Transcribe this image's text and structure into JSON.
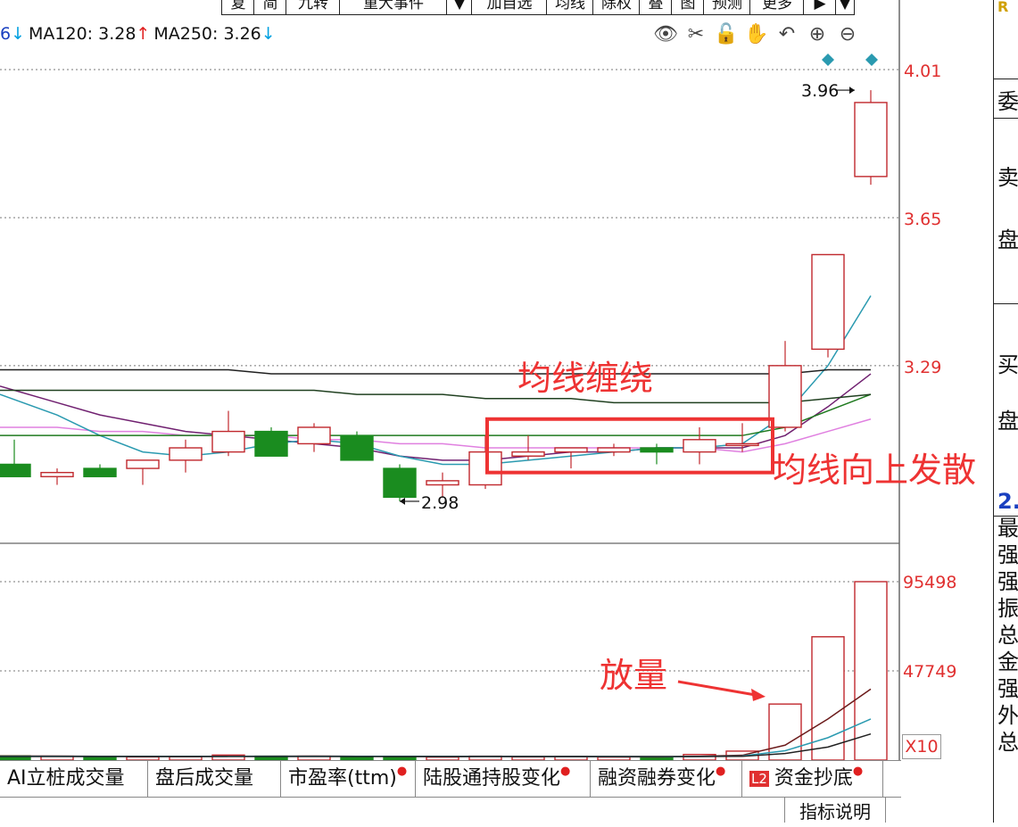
{
  "toolbar": {
    "buttons": [
      "复",
      "简",
      "九转",
      "重大事件",
      "▼",
      "加自选",
      "均线",
      "除权",
      "叠",
      "图",
      "预测",
      "更多",
      "▶",
      "▼"
    ]
  },
  "ma_line": {
    "items": [
      {
        "label": "6",
        "arrow": "↓",
        "dir": "down"
      },
      {
        "label": "MA120: 3.28",
        "arrow": "↑",
        "dir": "up"
      },
      {
        "label": "MA250: 3.26",
        "arrow": "↓",
        "dir": "down"
      }
    ]
  },
  "tools": [
    "eye-icon",
    "scissors-icon",
    "lock-icon",
    "hand-icon",
    "undo-icon",
    "zoom-in-icon",
    "zoom-out-icon"
  ],
  "tool_glyphs": [
    "👁",
    "✂",
    "🔓",
    "✋",
    "↶",
    "⊕",
    "⊖"
  ],
  "price_axis": {
    "labels": [
      "4.01",
      "3.65",
      "3.29"
    ]
  },
  "volume_axis": {
    "labels": [
      "95498",
      "47749"
    ],
    "unit": "X10"
  },
  "price_markers": {
    "high": "3.96",
    "low": "2.98"
  },
  "annotations": {
    "ma_tangle": "均线缠绕",
    "ma_diverge": "均线向上发散",
    "volume_up": "放量"
  },
  "tabs": [
    {
      "label": "AI立桩成交量",
      "dot": false
    },
    {
      "label": "盘后成交量",
      "dot": false
    },
    {
      "label": "市盈率(ttm)",
      "dot": true
    },
    {
      "label": "陆股通持股变化",
      "dot": true
    },
    {
      "label": "融资融券变化",
      "dot": true
    },
    {
      "label": "资金抄底",
      "dot": true,
      "badge": "L2"
    }
  ],
  "explain_button": "指标说明",
  "right_panel": {
    "chars": [
      "R",
      "委",
      "卖",
      "盘",
      "买",
      "盘",
      "2.",
      "最",
      "强",
      "强",
      "振",
      "总",
      "金",
      "强",
      "外",
      "总"
    ]
  },
  "colors": {
    "up": "#c0282d",
    "down": "#1a8c1f",
    "annotation": "#ee3333",
    "axis_label": "#e03030",
    "ma_pink": "#e080e0",
    "ma_purple": "#702070",
    "ma_teal": "#2a9ab0",
    "ma_green": "#1f7a1f"
  },
  "chart_data": {
    "type": "candlestick",
    "price_ylim": [
      2.86,
      4.06
    ],
    "candles": [
      {
        "o": 3.05,
        "h": 3.11,
        "l": 3.02,
        "c": 3.02
      },
      {
        "o": 3.02,
        "h": 3.04,
        "l": 3.0,
        "c": 3.03
      },
      {
        "o": 3.04,
        "h": 3.05,
        "l": 3.02,
        "c": 3.02
      },
      {
        "o": 3.04,
        "h": 3.06,
        "l": 3.0,
        "c": 3.06
      },
      {
        "o": 3.06,
        "h": 3.11,
        "l": 3.03,
        "c": 3.09
      },
      {
        "o": 3.08,
        "h": 3.18,
        "l": 3.07,
        "c": 3.13
      },
      {
        "o": 3.13,
        "h": 3.14,
        "l": 3.07,
        "c": 3.07
      },
      {
        "o": 3.1,
        "h": 3.15,
        "l": 3.08,
        "c": 3.14
      },
      {
        "o": 3.12,
        "h": 3.13,
        "l": 3.06,
        "c": 3.06
      },
      {
        "o": 3.04,
        "h": 3.05,
        "l": 2.96,
        "c": 2.97
      },
      {
        "o": 3.0,
        "h": 3.03,
        "l": 2.97,
        "c": 3.01
      },
      {
        "o": 3.0,
        "h": 3.12,
        "l": 2.99,
        "c": 3.08
      },
      {
        "o": 3.07,
        "h": 3.12,
        "l": 3.06,
        "c": 3.08
      },
      {
        "o": 3.08,
        "h": 3.09,
        "l": 3.04,
        "c": 3.09
      },
      {
        "o": 3.08,
        "h": 3.1,
        "l": 3.07,
        "c": 3.09
      },
      {
        "o": 3.09,
        "h": 3.1,
        "l": 3.05,
        "c": 3.08
      },
      {
        "o": 3.08,
        "h": 3.14,
        "l": 3.05,
        "c": 3.11
      },
      {
        "o": 3.1,
        "h": 3.15,
        "l": 3.08,
        "c": 3.1
      },
      {
        "o": 3.14,
        "h": 3.35,
        "l": 3.13,
        "c": 3.29
      },
      {
        "o": 3.33,
        "h": 3.56,
        "l": 3.31,
        "c": 3.56
      },
      {
        "o": 3.75,
        "h": 3.96,
        "l": 3.73,
        "c": 3.93
      }
    ],
    "volume_ylim": [
      0,
      95498
    ],
    "volume": [
      2300,
      2100,
      1700,
      1700,
      1800,
      2700,
      2100,
      2100,
      1800,
      1700,
      1600,
      2100,
      1700,
      1900,
      1600,
      1300,
      3000,
      4800,
      30000,
      66000,
      95498
    ],
    "ma_lines": [
      {
        "name": "ma-pink",
        "color": "#e080e0",
        "values": [
          3.14,
          3.14,
          3.13,
          3.13,
          3.12,
          3.12,
          3.12,
          3.11,
          3.11,
          3.1,
          3.1,
          3.09,
          3.09,
          3.09,
          3.09,
          3.09,
          3.09,
          3.08,
          3.1,
          3.13,
          3.16
        ]
      },
      {
        "name": "ma-purple",
        "color": "#702070",
        "values": [
          3.24,
          3.2,
          3.17,
          3.15,
          3.13,
          3.12,
          3.11,
          3.1,
          3.09,
          3.07,
          3.06,
          3.06,
          3.07,
          3.08,
          3.08,
          3.09,
          3.09,
          3.09,
          3.12,
          3.19,
          3.27
        ]
      },
      {
        "name": "ma-teal",
        "color": "#2a9ab0",
        "values": [
          3.22,
          3.17,
          3.12,
          3.08,
          3.07,
          3.08,
          3.1,
          3.11,
          3.1,
          3.07,
          3.05,
          3.05,
          3.06,
          3.07,
          3.08,
          3.09,
          3.09,
          3.1,
          3.17,
          3.29,
          3.46
        ]
      },
      {
        "name": "ma-green",
        "color": "#1f7a1f",
        "values": [
          3.12,
          3.12,
          3.12,
          3.12,
          3.12,
          3.12,
          3.12,
          3.12,
          3.12,
          3.12,
          3.12,
          3.12,
          3.12,
          3.12,
          3.12,
          3.12,
          3.12,
          3.12,
          3.14,
          3.18,
          3.22
        ]
      },
      {
        "name": "ma-darkgreen",
        "color": "#204020",
        "values": [
          3.23,
          3.23,
          3.23,
          3.23,
          3.23,
          3.23,
          3.23,
          3.23,
          3.22,
          3.22,
          3.22,
          3.21,
          3.21,
          3.21,
          3.2,
          3.2,
          3.2,
          3.2,
          3.2,
          3.21,
          3.22
        ]
      },
      {
        "name": "ma-black",
        "color": "#202020",
        "values": [
          3.28,
          3.28,
          3.28,
          3.28,
          3.28,
          3.28,
          3.27,
          3.27,
          3.27,
          3.27,
          3.27,
          3.27,
          3.27,
          3.27,
          3.27,
          3.27,
          3.27,
          3.27,
          3.27,
          3.28,
          3.28
        ]
      }
    ],
    "vol_ma_lines": [
      {
        "name": "vol-ma-dark",
        "color": "#6b1a1a",
        "values": [
          2200,
          2150,
          2050,
          1950,
          1900,
          2050,
          2100,
          2150,
          2050,
          1950,
          1850,
          1950,
          1900,
          1850,
          1800,
          1700,
          2000,
          2600,
          8000,
          22000,
          38000
        ]
      },
      {
        "name": "vol-ma-teal",
        "color": "#2a9ab0",
        "values": [
          2000,
          2000,
          1950,
          1950,
          1950,
          2000,
          2000,
          2050,
          2000,
          2000,
          1950,
          1950,
          1900,
          1900,
          1900,
          1850,
          1900,
          2200,
          5000,
          12000,
          22000
        ]
      },
      {
        "name": "vol-ma-black",
        "color": "#202020",
        "values": [
          1900,
          1900,
          1900,
          1900,
          1900,
          1900,
          1900,
          1900,
          1900,
          1900,
          1900,
          1900,
          1900,
          1900,
          1900,
          1900,
          1900,
          2000,
          3500,
          7000,
          14000
        ]
      }
    ]
  }
}
